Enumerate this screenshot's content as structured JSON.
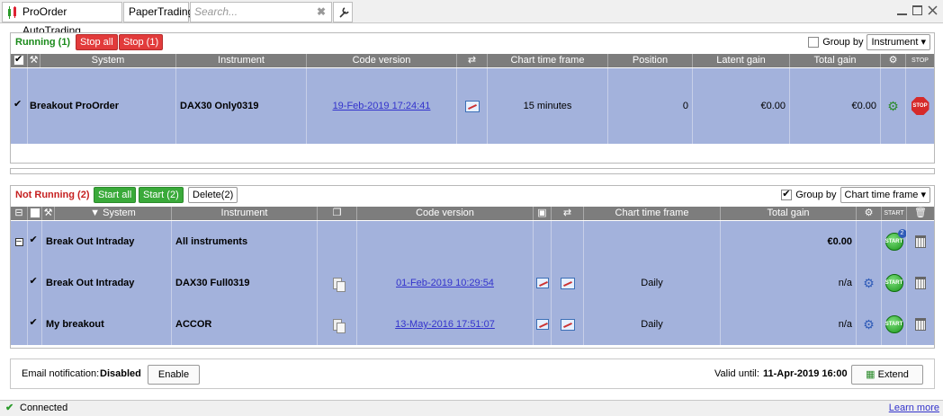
{
  "tabs": {
    "app": "ProOrder AutoTrading",
    "mode": "PaperTrading",
    "search_placeholder": "Search...",
    "search_clear": "✖"
  },
  "running": {
    "label": "Running (1)",
    "stop_all": "Stop all",
    "stop_n": "Stop (1)",
    "group_by": "Group by",
    "group_by_value": "Instrument",
    "headers": {
      "system": "System",
      "instrument": "Instrument",
      "code_version": "Code version",
      "chart_tf": "Chart time frame",
      "position": "Position",
      "latent_gain": "Latent gain",
      "total_gain": "Total gain"
    },
    "rows": [
      {
        "system": "Breakout ProOrder",
        "instrument": "DAX30 Only0319",
        "code_version": "19-Feb-2019 17:24:41",
        "chart_tf": "15 minutes",
        "position": "0",
        "latent_gain": "€0.00",
        "total_gain": "€0.00"
      }
    ]
  },
  "not_running": {
    "label": "Not Running (2)",
    "start_all": "Start all",
    "start_n": "Start (2)",
    "delete_n": "Delete(2)",
    "group_by": "Group by",
    "group_by_value": "Chart time frame",
    "headers": {
      "system": "System",
      "instrument": "Instrument",
      "code_version": "Code version",
      "chart_tf": "Chart time frame",
      "total_gain": "Total gain"
    },
    "group_row": {
      "system": "Break Out Intraday",
      "instrument": "All instruments",
      "total_gain": "€0.00",
      "badge": "2"
    },
    "rows": [
      {
        "system": "Break Out Intraday",
        "instrument": "DAX30 Full0319",
        "code_version": "01-Feb-2019 10:29:54",
        "chart_tf": "Daily",
        "total_gain": "n/a"
      },
      {
        "system": "My breakout",
        "instrument": "ACCOR",
        "code_version": "13-May-2016 17:51:07",
        "chart_tf": "Daily",
        "total_gain": "n/a"
      }
    ]
  },
  "footer": {
    "email_label": "Email notification:",
    "email_status": "Disabled",
    "enable": "Enable",
    "valid_label": "Valid until:",
    "valid_date": "11-Apr-2019 16:00",
    "extend": "Extend"
  },
  "status": {
    "connected": "Connected",
    "learn_more": "Learn more"
  },
  "icons": {
    "start": "START",
    "stop": "STOP"
  }
}
